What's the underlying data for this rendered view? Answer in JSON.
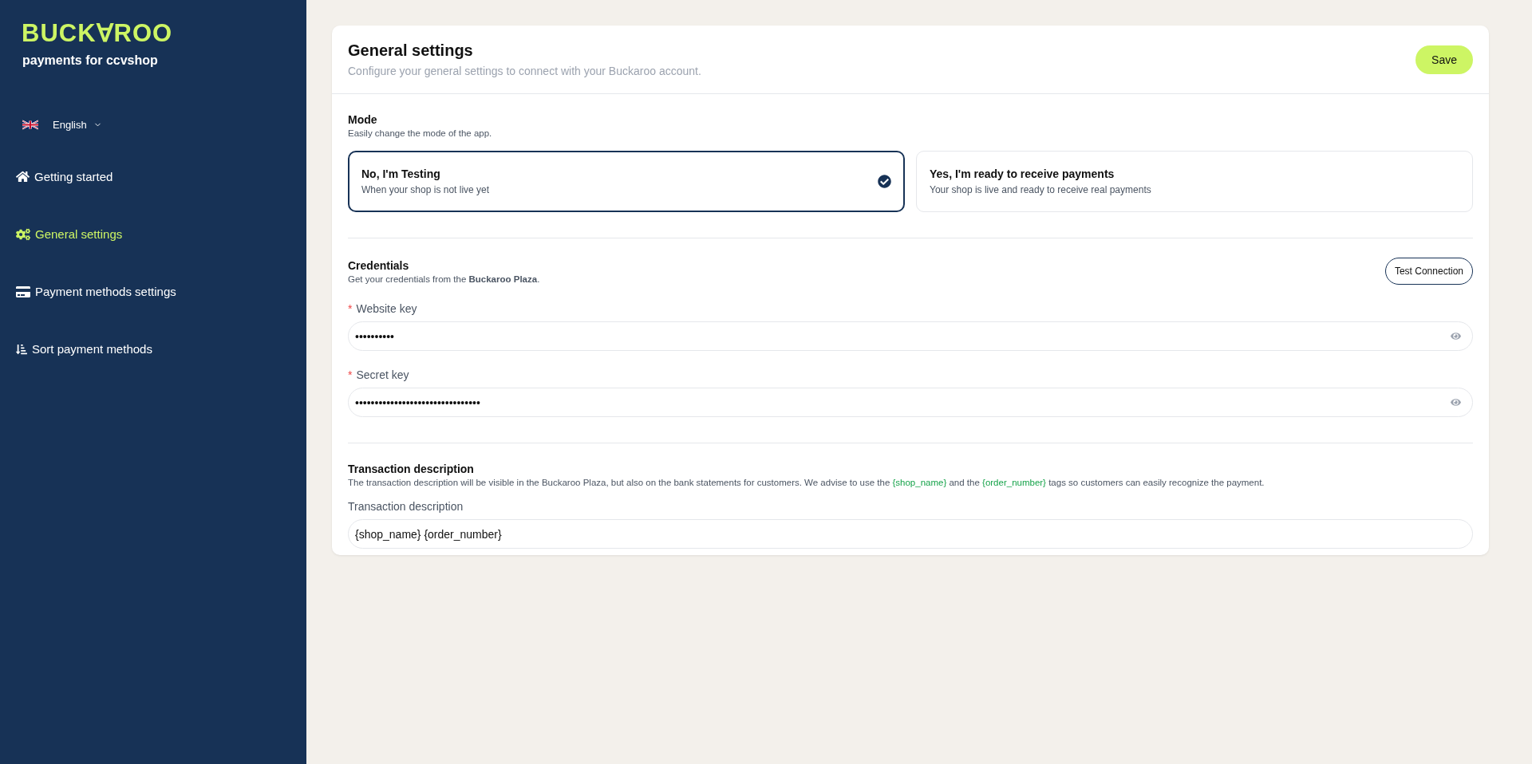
{
  "sidebar": {
    "logo": "BUCK∀ROO",
    "tagline": "payments for ccvshop",
    "language": {
      "label": "English"
    },
    "items": [
      {
        "label": "Getting started",
        "kind": "home",
        "selected": false
      },
      {
        "label": "General settings",
        "kind": "settings",
        "selected": true
      },
      {
        "label": "Payment methods settings",
        "kind": "payment",
        "selected": false
      },
      {
        "label": "Sort payment methods",
        "kind": "sort",
        "selected": false
      }
    ]
  },
  "header": {
    "title": "General settings",
    "subtitle": "Configure your general settings to connect with your Buckaroo account.",
    "save_button": "Save"
  },
  "mode": {
    "title": "Mode",
    "description": "Easily change the mode of the app.",
    "options": [
      {
        "title": "No, I'm Testing",
        "description": "When your shop is not live yet",
        "selected": true
      },
      {
        "title": "Yes, I'm ready to receive payments",
        "description": "Your shop is live and ready to receive real payments",
        "selected": false
      }
    ]
  },
  "credentials": {
    "title": "Credentials",
    "description": "Get your credentials from the **Buckaroo Plaza**.",
    "test_button": "Test Connection",
    "fields": [
      {
        "label": "Website key",
        "required_mark": "*",
        "value": "••••••••••"
      },
      {
        "label": "Secret key",
        "required_mark": "*",
        "value": "••••••••••••••••••••••••••••••••"
      }
    ]
  },
  "transaction": {
    "title": "Transaction description",
    "description": [
      {
        "kind": "plain",
        "text": "The transaction description will be visible in the Buckaroo Plaza, but also on the bank statements for customers. We advise to use the "
      },
      {
        "kind": "tag",
        "text": "{shop_name}"
      },
      {
        "kind": "plain",
        "text": " and the "
      },
      {
        "kind": "tag",
        "text": "{order_number}"
      },
      {
        "kind": "plain",
        "text": " tags so customers can easily recognize the payment."
      }
    ],
    "field": {
      "label": "Transaction description",
      "value": "{shop_name} {order_number}"
    }
  }
}
